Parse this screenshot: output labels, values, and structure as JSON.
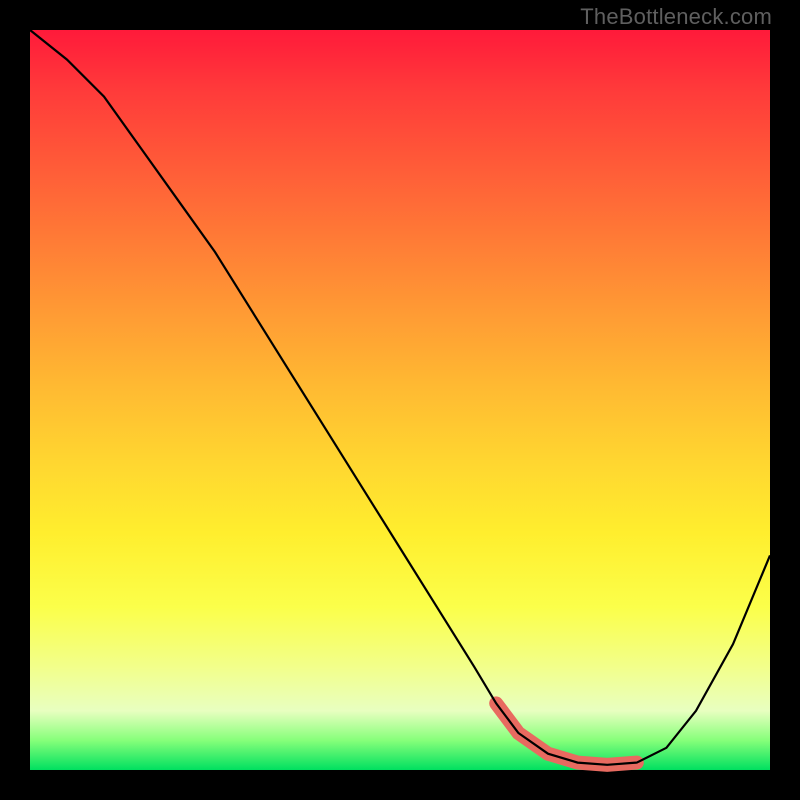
{
  "watermark": "TheBottleneck.com",
  "colors": {
    "frame": "#000000",
    "curve": "#000000",
    "highlight_band": "#e86a60",
    "gradient_top": "#ff1a3a",
    "gradient_bottom": "#00e060"
  },
  "chart_data": {
    "type": "line",
    "title": "",
    "xlabel": "",
    "ylabel": "",
    "xlim": [
      0,
      100
    ],
    "ylim": [
      0,
      100
    ],
    "grid": false,
    "legend": false,
    "series": [
      {
        "name": "bottleneck-curve",
        "x": [
          0,
          5,
          10,
          15,
          20,
          25,
          30,
          35,
          40,
          45,
          50,
          55,
          60,
          63,
          66,
          70,
          74,
          78,
          82,
          86,
          90,
          95,
          100
        ],
        "y": [
          100,
          96,
          91,
          84,
          77,
          70,
          62,
          54,
          46,
          38,
          30,
          22,
          14,
          9,
          5,
          2.2,
          1.0,
          0.7,
          1.0,
          3.0,
          8,
          17,
          29
        ]
      }
    ],
    "annotations": [
      {
        "name": "optimal-zone",
        "kind": "range-highlight",
        "axis": "x",
        "from": 63,
        "to": 82,
        "color": "#e86a60"
      }
    ],
    "background_gradient": {
      "direction": "vertical",
      "stops": [
        {
          "pos": 0.0,
          "color": "#ff1a3a"
        },
        {
          "pos": 0.5,
          "color": "#ffb932"
        },
        {
          "pos": 0.8,
          "color": "#fbff4a"
        },
        {
          "pos": 0.96,
          "color": "#86ff7a"
        },
        {
          "pos": 1.0,
          "color": "#00e060"
        }
      ]
    }
  }
}
